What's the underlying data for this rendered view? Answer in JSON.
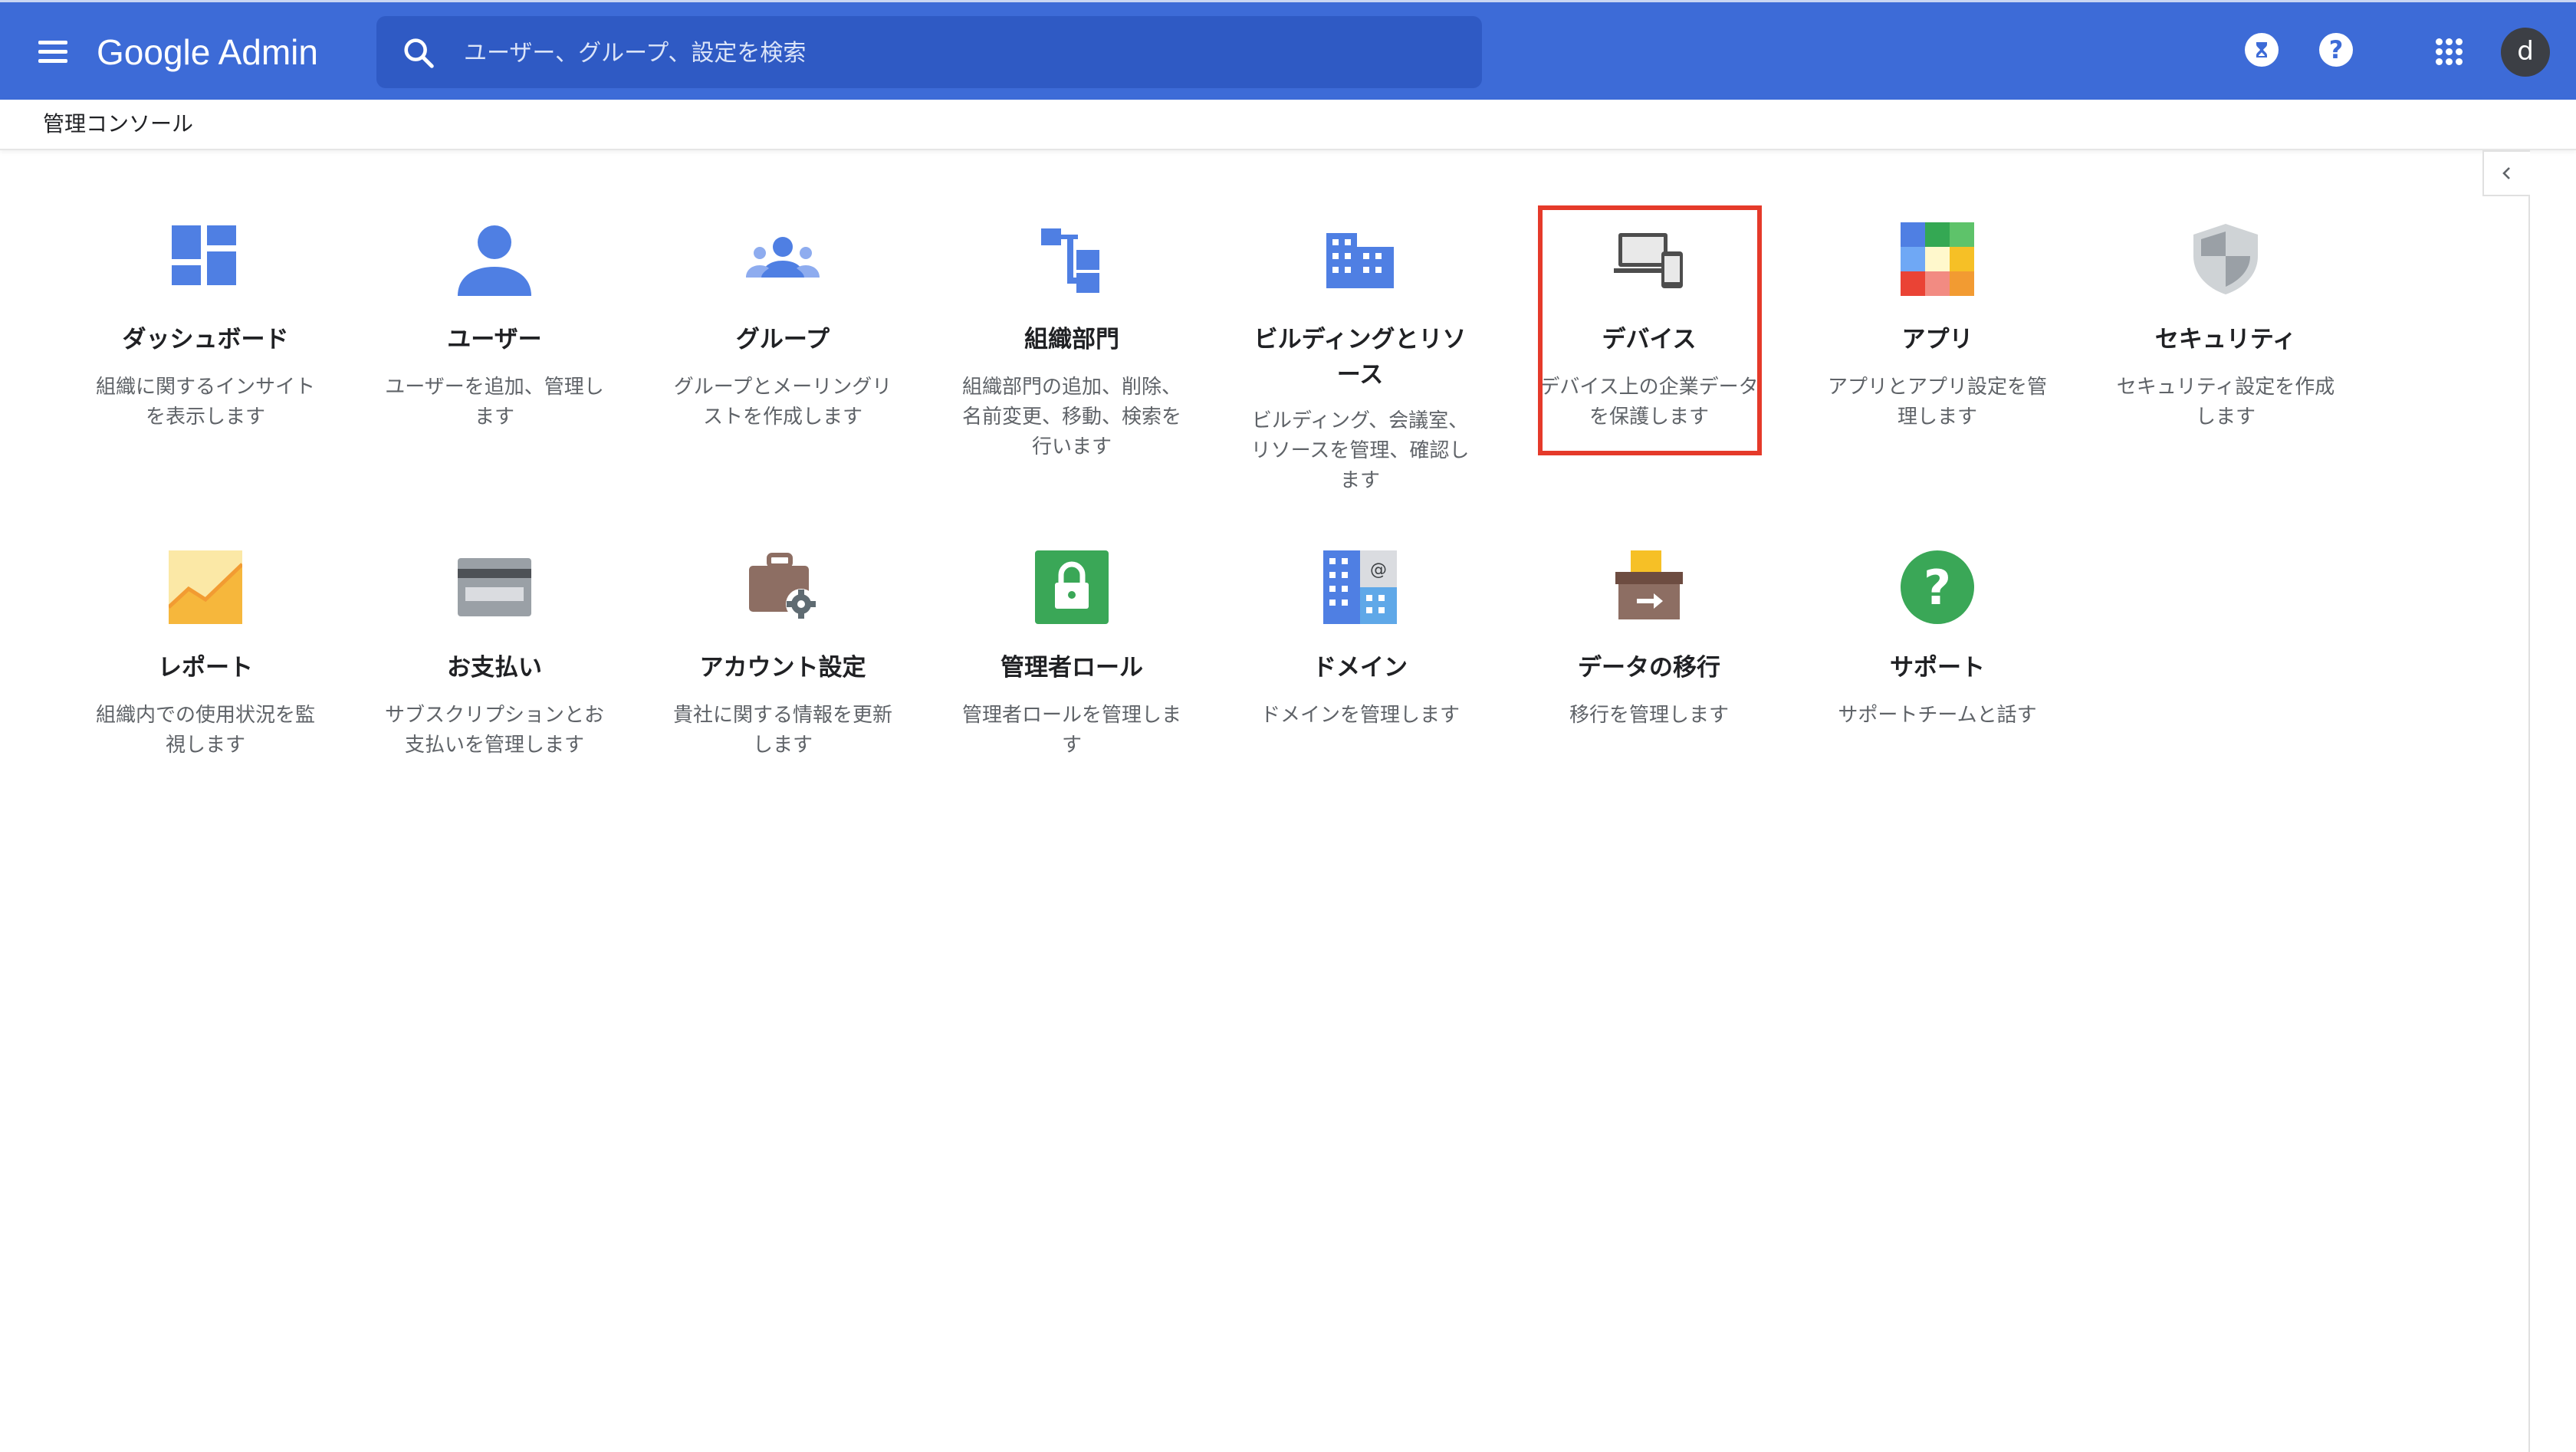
{
  "header": {
    "app_title": "Google Admin",
    "search_placeholder": "ユーザー、グループ、設定を検索",
    "help_glyph": "?",
    "avatar_letter": "d",
    "color": "#3d6bd7"
  },
  "breadcrumb": {
    "label": "管理コンソール"
  },
  "tiles": [
    {
      "title": "ダッシュボード",
      "desc": "組織に関するインサイトを表示します",
      "icon": "dashboard-icon"
    },
    {
      "title": "ユーザー",
      "desc": "ユーザーを追加、管理します",
      "icon": "user-icon"
    },
    {
      "title": "グループ",
      "desc": "グループとメーリングリストを作成します",
      "icon": "groups-icon"
    },
    {
      "title": "組織部門",
      "desc": "組織部門の追加、削除、名前変更、移動、検索を行います",
      "icon": "org-units-icon"
    },
    {
      "title": "ビルディングとリソース",
      "desc": "ビルディング、会議室、リソースを管理、確認します",
      "icon": "building-icon"
    },
    {
      "title": "デバイス",
      "desc": "デバイス上の企業データを保護します",
      "icon": "devices-icon",
      "highlighted": true
    },
    {
      "title": "アプリ",
      "desc": "アプリとアプリ設定を管理します",
      "icon": "apps-grid-icon"
    },
    {
      "title": "セキュリティ",
      "desc": "セキュリティ設定を作成します",
      "icon": "shield-icon"
    },
    {
      "title": "レポート",
      "desc": "組織内での使用状況を監視します",
      "icon": "reports-chart-icon"
    },
    {
      "title": "お支払い",
      "desc": "サブスクリプションとお支払いを管理します",
      "icon": "credit-card-icon"
    },
    {
      "title": "アカウント設定",
      "desc": "貴社に関する情報を更新します",
      "icon": "briefcase-gear-icon"
    },
    {
      "title": "管理者ロール",
      "desc": "管理者ロールを管理します",
      "icon": "lock-icon"
    },
    {
      "title": "ドメイン",
      "desc": "ドメインを管理します",
      "icon": "domain-building-icon"
    },
    {
      "title": "データの移行",
      "desc": "移行を管理します",
      "icon": "data-migration-icon"
    },
    {
      "title": "サポート",
      "desc": "サポートチームと話す",
      "icon": "help-circle-icon"
    }
  ]
}
